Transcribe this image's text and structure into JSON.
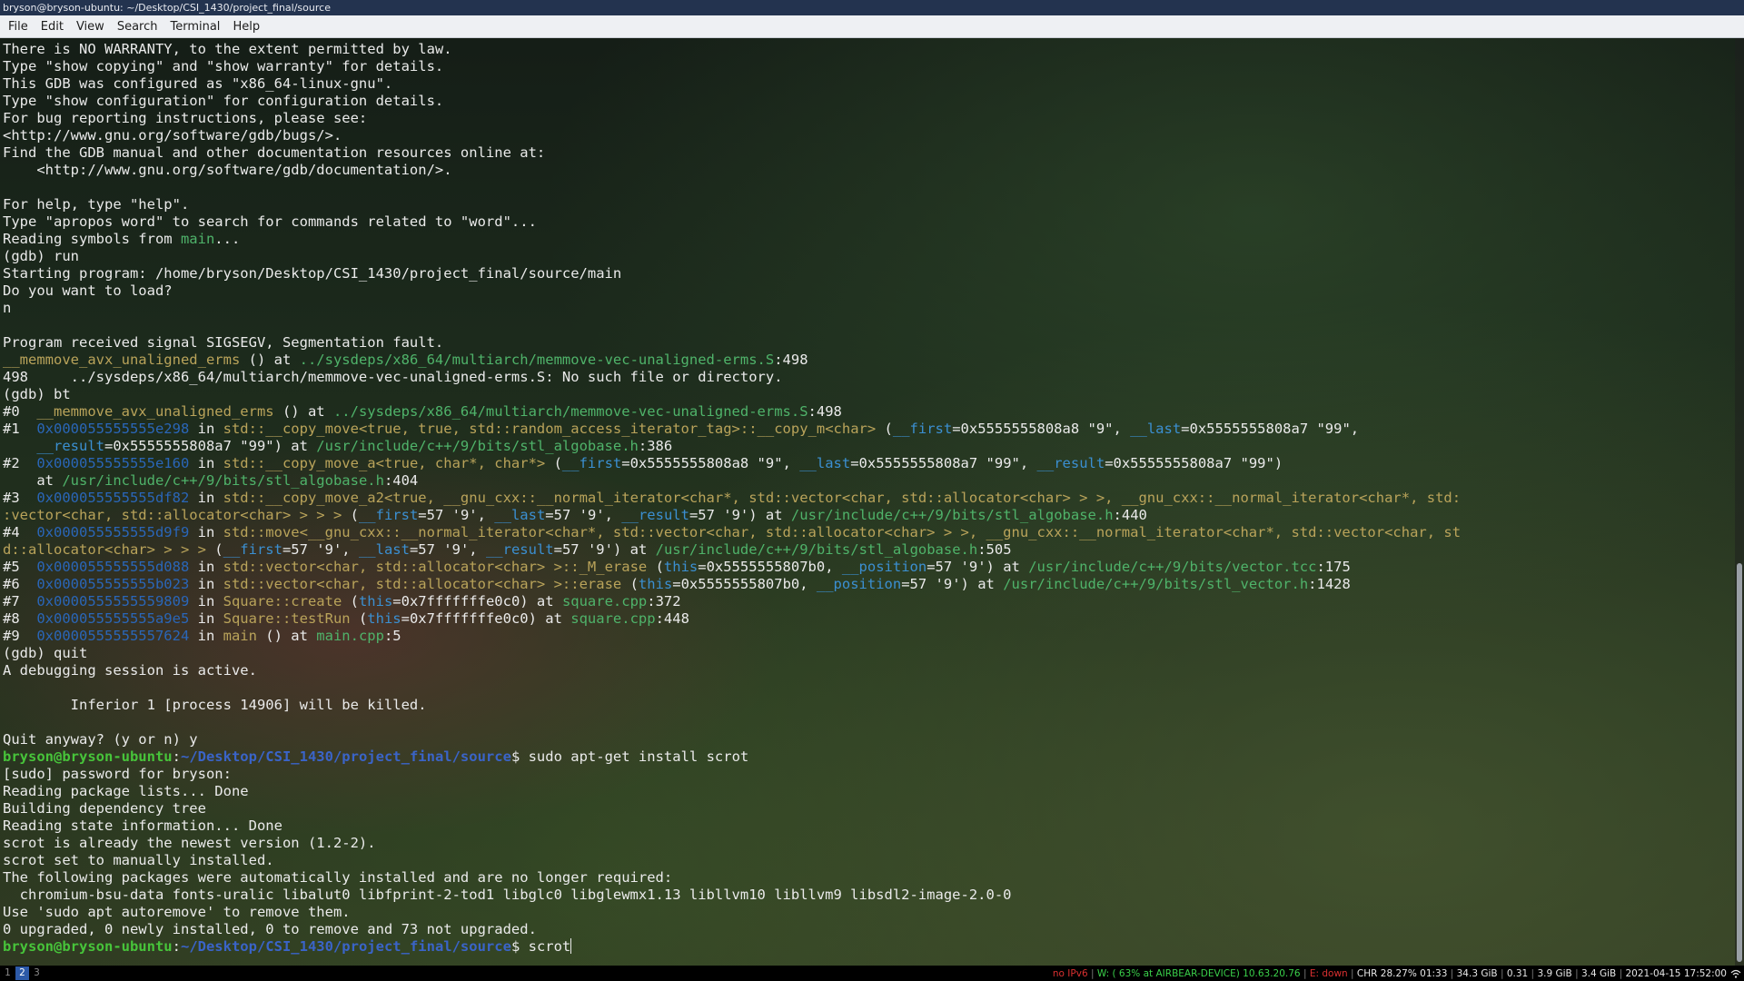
{
  "window": {
    "title": "bryson@bryson-ubuntu: ~/Desktop/CSI_1430/project_final/source"
  },
  "menu": [
    "File",
    "Edit",
    "View",
    "Search",
    "Terminal",
    "Help"
  ],
  "colors": {
    "address": "#2a66b8",
    "function": "#b9a35a",
    "file": "#4fb36a",
    "argument": "#3b8fd1",
    "prompt_user": "#47c43a",
    "prompt_path": "#3a64c8"
  },
  "terminal_lines": [
    [
      {
        "t": "There is NO WARRANTY, to the extent permitted by law."
      }
    ],
    [
      {
        "t": "Type \"show copying\" and \"show warranty\" for details."
      }
    ],
    [
      {
        "t": "This GDB was configured as \"x86_64-linux-gnu\"."
      }
    ],
    [
      {
        "t": "Type \"show configuration\" for configuration details."
      }
    ],
    [
      {
        "t": "For bug reporting instructions, please see:"
      }
    ],
    [
      {
        "t": "<http://www.gnu.org/software/gdb/bugs/>."
      }
    ],
    [
      {
        "t": "Find the GDB manual and other documentation resources online at:"
      }
    ],
    [
      {
        "t": "    <http://www.gnu.org/software/gdb/documentation/>."
      }
    ],
    [
      {
        "t": ""
      }
    ],
    [
      {
        "t": "For help, type \"help\"."
      }
    ],
    [
      {
        "t": "Type \"apropos word\" to search for commands related to \"word\"..."
      }
    ],
    [
      {
        "t": "Reading symbols from "
      },
      {
        "t": "main",
        "c": "file"
      },
      {
        "t": "..."
      }
    ],
    [
      {
        "t": "(gdb) run"
      }
    ],
    [
      {
        "t": "Starting program: /home/bryson/Desktop/CSI_1430/project_final/source/main"
      }
    ],
    [
      {
        "t": "Do you want to load?"
      }
    ],
    [
      {
        "t": "n"
      }
    ],
    [
      {
        "t": ""
      }
    ],
    [
      {
        "t": "Program received signal SIGSEGV, Segmentation fault."
      }
    ],
    [
      {
        "t": "__memmove_avx_unaligned_erms",
        "c": "fn"
      },
      {
        "t": " () at "
      },
      {
        "t": "../sysdeps/x86_64/multiarch/memmove-vec-unaligned-erms.S",
        "c": "file"
      },
      {
        "t": ":498"
      }
    ],
    [
      {
        "t": "498     ../sysdeps/x86_64/multiarch/memmove-vec-unaligned-erms.S: No such file or directory."
      }
    ],
    [
      {
        "t": "(gdb) bt"
      }
    ],
    [
      {
        "t": "#0  "
      },
      {
        "t": "__memmove_avx_unaligned_erms",
        "c": "fn"
      },
      {
        "t": " () at "
      },
      {
        "t": "../sysdeps/x86_64/multiarch/memmove-vec-unaligned-erms.S",
        "c": "file"
      },
      {
        "t": ":498"
      }
    ],
    [
      {
        "t": "#1  "
      },
      {
        "t": "0x000055555555e298",
        "c": "addr"
      },
      {
        "t": " in "
      },
      {
        "t": "std::__copy_move<true, true, std::random_access_iterator_tag>::__copy_m<char>",
        "c": "fn"
      },
      {
        "t": " ("
      },
      {
        "t": "__first",
        "c": "arg"
      },
      {
        "t": "=0x5555555808a8 \"9\", "
      },
      {
        "t": "__last",
        "c": "arg"
      },
      {
        "t": "=0x5555555808a7 \"99\","
      }
    ],
    [
      {
        "t": "    "
      },
      {
        "t": "__result",
        "c": "arg"
      },
      {
        "t": "=0x5555555808a7 \"99\") at "
      },
      {
        "t": "/usr/include/c++/9/bits/stl_algobase.h",
        "c": "file"
      },
      {
        "t": ":386"
      }
    ],
    [
      {
        "t": "#2  "
      },
      {
        "t": "0x000055555555e160",
        "c": "addr"
      },
      {
        "t": " in "
      },
      {
        "t": "std::__copy_move_a<true, char*, char*>",
        "c": "fn"
      },
      {
        "t": " ("
      },
      {
        "t": "__first",
        "c": "arg"
      },
      {
        "t": "=0x5555555808a8 \"9\", "
      },
      {
        "t": "__last",
        "c": "arg"
      },
      {
        "t": "=0x5555555808a7 \"99\", "
      },
      {
        "t": "__result",
        "c": "arg"
      },
      {
        "t": "=0x5555555808a7 \"99\")"
      }
    ],
    [
      {
        "t": "    at "
      },
      {
        "t": "/usr/include/c++/9/bits/stl_algobase.h",
        "c": "file"
      },
      {
        "t": ":404"
      }
    ],
    [
      {
        "t": "#3  "
      },
      {
        "t": "0x000055555555df82",
        "c": "addr"
      },
      {
        "t": " in "
      },
      {
        "t": "std::__copy_move_a2<true, __gnu_cxx::__normal_iterator<char*, std::vector<char, std::allocator<char> > >, __gnu_cxx::__normal_iterator<char*, std:",
        "c": "fn"
      }
    ],
    [
      {
        "t": ":vector<char, std::allocator<char> > > >",
        "c": "fn"
      },
      {
        "t": " ("
      },
      {
        "t": "__first",
        "c": "arg"
      },
      {
        "t": "=57 '9', "
      },
      {
        "t": "__last",
        "c": "arg"
      },
      {
        "t": "=57 '9', "
      },
      {
        "t": "__result",
        "c": "arg"
      },
      {
        "t": "=57 '9') at "
      },
      {
        "t": "/usr/include/c++/9/bits/stl_algobase.h",
        "c": "file"
      },
      {
        "t": ":440"
      }
    ],
    [
      {
        "t": "#4  "
      },
      {
        "t": "0x000055555555d9f9",
        "c": "addr"
      },
      {
        "t": " in "
      },
      {
        "t": "std::move<__gnu_cxx::__normal_iterator<char*, std::vector<char, std::allocator<char> > >, __gnu_cxx::__normal_iterator<char*, std::vector<char, st",
        "c": "fn"
      }
    ],
    [
      {
        "t": "d::allocator<char> > > >",
        "c": "fn"
      },
      {
        "t": " ("
      },
      {
        "t": "__first",
        "c": "arg"
      },
      {
        "t": "=57 '9', "
      },
      {
        "t": "__last",
        "c": "arg"
      },
      {
        "t": "=57 '9', "
      },
      {
        "t": "__result",
        "c": "arg"
      },
      {
        "t": "=57 '9') at "
      },
      {
        "t": "/usr/include/c++/9/bits/stl_algobase.h",
        "c": "file"
      },
      {
        "t": ":505"
      }
    ],
    [
      {
        "t": "#5  "
      },
      {
        "t": "0x000055555555d088",
        "c": "addr"
      },
      {
        "t": " in "
      },
      {
        "t": "std::vector<char, std::allocator<char> >::_M_erase",
        "c": "fn"
      },
      {
        "t": " ("
      },
      {
        "t": "this",
        "c": "arg"
      },
      {
        "t": "=0x5555555807b0, "
      },
      {
        "t": "__position",
        "c": "arg"
      },
      {
        "t": "=57 '9') at "
      },
      {
        "t": "/usr/include/c++/9/bits/vector.tcc",
        "c": "file"
      },
      {
        "t": ":175"
      }
    ],
    [
      {
        "t": "#6  "
      },
      {
        "t": "0x000055555555b023",
        "c": "addr"
      },
      {
        "t": " in "
      },
      {
        "t": "std::vector<char, std::allocator<char> >::erase",
        "c": "fn"
      },
      {
        "t": " ("
      },
      {
        "t": "this",
        "c": "arg"
      },
      {
        "t": "=0x5555555807b0, "
      },
      {
        "t": "__position",
        "c": "arg"
      },
      {
        "t": "=57 '9') at "
      },
      {
        "t": "/usr/include/c++/9/bits/stl_vector.h",
        "c": "file"
      },
      {
        "t": ":1428"
      }
    ],
    [
      {
        "t": "#7  "
      },
      {
        "t": "0x0000555555559809",
        "c": "addr"
      },
      {
        "t": " in "
      },
      {
        "t": "Square::create",
        "c": "fn"
      },
      {
        "t": " ("
      },
      {
        "t": "this",
        "c": "arg"
      },
      {
        "t": "=0x7fffffffe0c0) at "
      },
      {
        "t": "square.cpp",
        "c": "file"
      },
      {
        "t": ":372"
      }
    ],
    [
      {
        "t": "#8  "
      },
      {
        "t": "0x000055555555a9e5",
        "c": "addr"
      },
      {
        "t": " in "
      },
      {
        "t": "Square::testRun",
        "c": "fn"
      },
      {
        "t": " ("
      },
      {
        "t": "this",
        "c": "arg"
      },
      {
        "t": "=0x7fffffffe0c0) at "
      },
      {
        "t": "square.cpp",
        "c": "file"
      },
      {
        "t": ":448"
      }
    ],
    [
      {
        "t": "#9  "
      },
      {
        "t": "0x0000555555557624",
        "c": "addr"
      },
      {
        "t": " in "
      },
      {
        "t": "main",
        "c": "fn"
      },
      {
        "t": " () at "
      },
      {
        "t": "main.cpp",
        "c": "file"
      },
      {
        "t": ":5"
      }
    ],
    [
      {
        "t": "(gdb) quit"
      }
    ],
    [
      {
        "t": "A debugging session is active."
      }
    ],
    [
      {
        "t": ""
      }
    ],
    [
      {
        "t": "        Inferior 1 [process 14906] will be killed."
      }
    ],
    [
      {
        "t": ""
      }
    ],
    [
      {
        "t": "Quit anyway? (y or n) y"
      }
    ],
    [
      {
        "t": "bryson@bryson-ubuntu",
        "c": "prompt-user"
      },
      {
        "t": ":"
      },
      {
        "t": "~/Desktop/CSI_1430/project_final/source",
        "c": "prompt-path"
      },
      {
        "t": "$ sudo apt-get install scrot"
      }
    ],
    [
      {
        "t": "[sudo] password for bryson:"
      }
    ],
    [
      {
        "t": "Reading package lists... Done"
      }
    ],
    [
      {
        "t": "Building dependency tree"
      }
    ],
    [
      {
        "t": "Reading state information... Done"
      }
    ],
    [
      {
        "t": "scrot is already the newest version (1.2-2)."
      }
    ],
    [
      {
        "t": "scrot set to manually installed."
      }
    ],
    [
      {
        "t": "The following packages were automatically installed and are no longer required:"
      }
    ],
    [
      {
        "t": "  chromium-bsu-data fonts-uralic libalut0 libfprint-2-tod1 libglc0 libglewmx1.13 libllvm10 libllvm9 libsdl2-image-2.0-0"
      }
    ],
    [
      {
        "t": "Use 'sudo apt autoremove' to remove them."
      }
    ],
    [
      {
        "t": "0 upgraded, 0 newly installed, 0 to remove and 73 not upgraded."
      }
    ]
  ],
  "current_prompt": {
    "user": "bryson@bryson-ubuntu",
    "sep": ":",
    "path": "~/Desktop/CSI_1430/project_final/source",
    "suffix": "$ ",
    "input": "scrot"
  },
  "scrollbar": {
    "thumb_fraction": 0.43,
    "position": "bottom"
  },
  "statusbar": {
    "workspaces": [
      {
        "label": "1",
        "active": false
      },
      {
        "label": "2",
        "active": true
      },
      {
        "label": "3",
        "active": false
      }
    ],
    "ipv6": "no IPv6",
    "wifi_prefix": "W: ( 63% at AIRBEAR-DEVICE) ",
    "wifi_ip": "10.63.20.76",
    "ethernet": "E: down",
    "battery": "CHR 28.27% 01:33",
    "disk": "34.3 GiB",
    "load": "0.31",
    "memory_used": "3.9 GiB",
    "memory_free": "3.4 GiB",
    "datetime": "2021-04-15 17:52:00",
    "tray_icon": "wifi-icon"
  }
}
